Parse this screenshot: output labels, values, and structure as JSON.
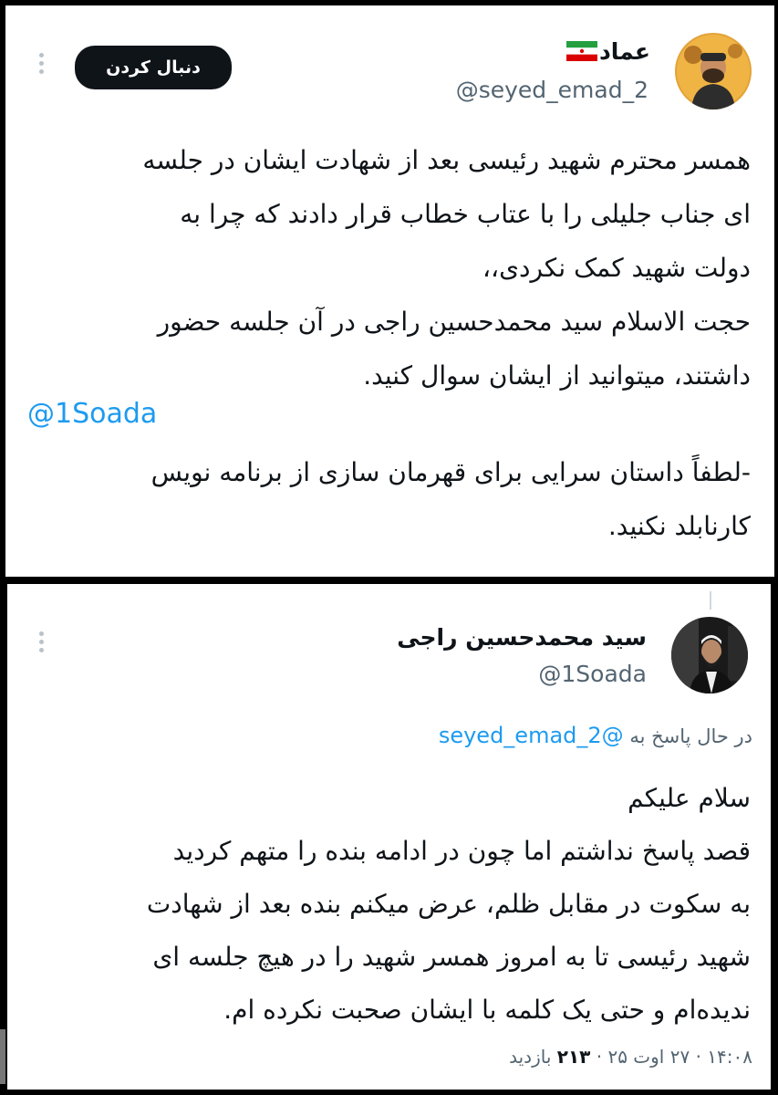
{
  "tweet_main": {
    "display_name": "عماد",
    "handle": "@seyed_emad_2",
    "follow_label": "دنبال کردن",
    "lines": [
      "همسر محترم شهید رئیسی بعد از شهادت ایشان در جلسه",
      "ای جناب جلیلی را با عتاب خطاب قرار دادند که چرا به",
      "دولت شهید کمک نکردی،،",
      "حجت الاسلام سید محمدحسین راجی در آن جلسه حضور",
      "داشتند، میتوانید از ایشان سوال کنید."
    ],
    "mention": "@1Soada",
    "lines_after": [
      "-لطفاً داستان سرایی برای قهرمان سازی از برنامه نویس",
      "کارنابلد نکنید."
    ]
  },
  "tweet_reply": {
    "display_name": "سید محمدحسین راجی",
    "handle": "@1Soada",
    "replying_prefix": "در حال پاسخ به",
    "replying_handle": "@seyed_emad_2",
    "lines": [
      "سلام علیکم",
      "قصد پاسخ نداشتم اما چون در ادامه بنده را متهم کردید",
      "به سکوت در مقابل ظلم، عرض میکنم بنده بعد از شهادت",
      "شهید رئیسی تا به امروز همسر شهید را در هیچ جلسه ای",
      "ندیده‌ام و حتی یک کلمه با ایشان صحبت نکرده ام."
    ],
    "meta_time": "۱۴:۰۸",
    "meta_date": "۲۷ اوت ۲۵",
    "meta_views_count": "۲۱۳",
    "meta_views_label": "بازدید",
    "meta_separator": "·"
  },
  "icons": {
    "more": "more-vertical-icon",
    "flag": "iran-flag-icon"
  },
  "colors": {
    "link": "#1d9bf0",
    "secondary_text": "#536471",
    "primary_text": "#0f1419",
    "follow_button_bg": "#0f1419"
  }
}
